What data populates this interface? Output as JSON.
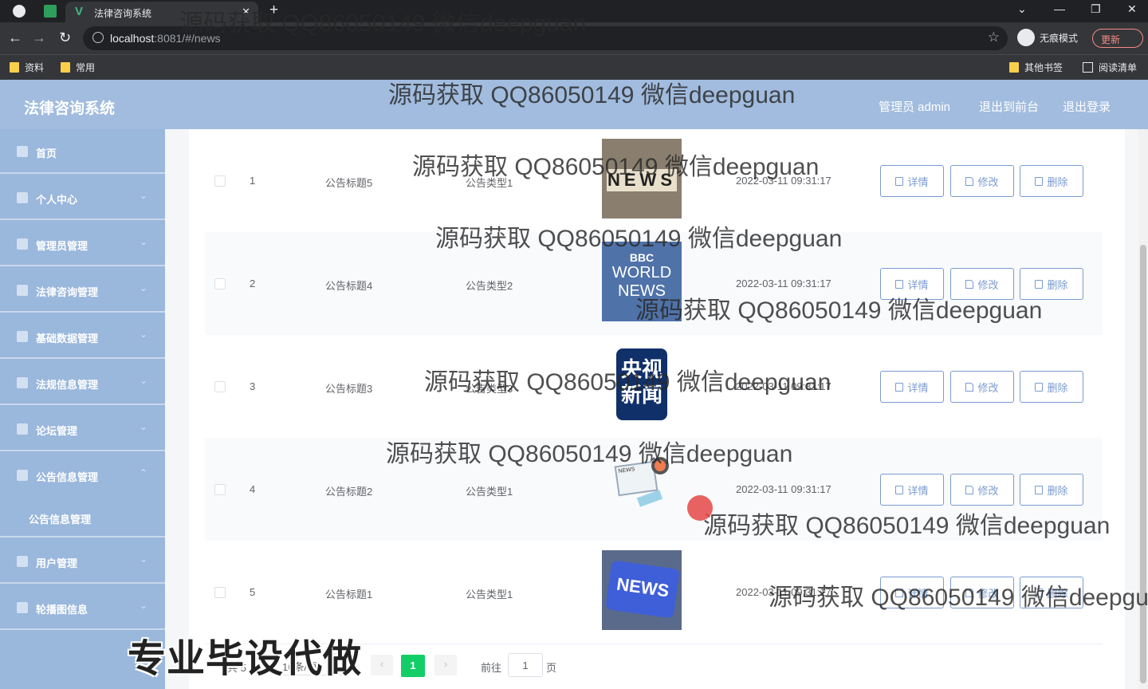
{
  "browser": {
    "tab_title": "法律咨询系统",
    "url_host": "localhost",
    "url_rest": ":8081/#/news",
    "incognito_label": "无痕模式",
    "update_label": "更新",
    "bookmarks": [
      "资料",
      "常用"
    ],
    "other_bookmarks": "其他书签",
    "reading_list": "阅读清单"
  },
  "header": {
    "app_title": "法律咨询系统",
    "user_label": "管理员 admin",
    "to_front": "退出到前台",
    "logout": "退出登录"
  },
  "sidebar": {
    "items": [
      {
        "label": "首页"
      },
      {
        "label": "个人中心"
      },
      {
        "label": "管理员管理"
      },
      {
        "label": "法律咨询管理"
      },
      {
        "label": "基础数据管理"
      },
      {
        "label": "法规信息管理"
      },
      {
        "label": "论坛管理"
      },
      {
        "label": "公告信息管理"
      },
      {
        "label": "用户管理"
      },
      {
        "label": "轮播图信息"
      }
    ],
    "submenu": "公告信息管理"
  },
  "table": {
    "rows": [
      {
        "index": "1",
        "title": "公告标题5",
        "type": "公告类型1",
        "time": "2022-03-11 09:31:17"
      },
      {
        "index": "2",
        "title": "公告标题4",
        "type": "公告类型2",
        "time": "2022-03-11 09:31:17"
      },
      {
        "index": "3",
        "title": "公告标题3",
        "type": "公告类型3",
        "time": "2022-03-11 09:31:17"
      },
      {
        "index": "4",
        "title": "公告标题2",
        "type": "公告类型1",
        "time": "2022-03-11 09:31:17"
      },
      {
        "index": "5",
        "title": "公告标题1",
        "type": "公告类型1",
        "time": "2022-03-11 09:31:17"
      }
    ],
    "actions": {
      "detail": "详情",
      "edit": "修改",
      "delete": "删除"
    }
  },
  "pagination": {
    "total": "共 5 条",
    "page_size": "10条/页",
    "current": "1",
    "goto": "前往",
    "input": "1",
    "page": "页"
  },
  "overlay": {
    "watermark": "源码获取 QQ86050149 微信deepguan",
    "promo": "专业毕设代做"
  },
  "thumbs": {
    "t1": "NEWS",
    "t2a": "BBC",
    "t2b": "WORLD",
    "t2c": "NEWS",
    "t3a": "央视",
    "t3b": "新闻",
    "t4": "NEWS",
    "t5": "NEWS"
  },
  "colors": {
    "header": "#a1bcde",
    "sidebar": "#9ab7dc",
    "button": "#7a9bd0",
    "pager_active": "#13ce66"
  }
}
